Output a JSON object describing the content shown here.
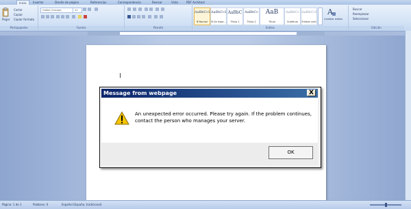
{
  "ribbon": {
    "tabs": [
      "Inicio",
      "Insertar",
      "Diseño de página",
      "Referencias",
      "Correspondencia",
      "Revisar",
      "Vista",
      "PDF Architect"
    ],
    "active_tab": "Inicio",
    "groups": [
      "Portapapeles",
      "Fuente",
      "Párrafo",
      "Estilos",
      "Edición"
    ],
    "paste_label": "Pegar",
    "clipboard_items": [
      "Cortar",
      "Copiar",
      "Copiar formato"
    ],
    "font_name": "Calibri (Cuerpo)",
    "font_size": "11",
    "styles": [
      {
        "sample": "AaBbCcDc",
        "name": "¶ Normal"
      },
      {
        "sample": "AaBbCcDc",
        "name": "¶ Sin espa..."
      },
      {
        "sample": "AaBbC",
        "name": "Título 1"
      },
      {
        "sample": "AaBbCc",
        "name": "Título 2"
      },
      {
        "sample": "AaB",
        "name": "Título"
      },
      {
        "sample": "AaBbCc",
        "name": "Subtítulo"
      },
      {
        "sample": "AaBbCcDc",
        "name": "Énfasis sutil"
      }
    ],
    "change_styles_label": "Cambiar estilos",
    "editing_items": [
      "Buscar",
      "Reemplazar",
      "Seleccionar"
    ]
  },
  "dialog": {
    "title": "Message from webpage",
    "close_glyph": "X",
    "message": "An unexpected error occurred. Please try again. If the problem continues, contact the person who manages your server.",
    "ok_label": "OK"
  },
  "statusbar": {
    "page": "Página: 1 de 1",
    "words": "Palabras: 0",
    "language": "Español (España, tradicional)"
  },
  "colors": {
    "title_bar_start": "#0a246a",
    "title_bar_end": "#3a6ea5",
    "warning_yellow": "#f6c400"
  }
}
